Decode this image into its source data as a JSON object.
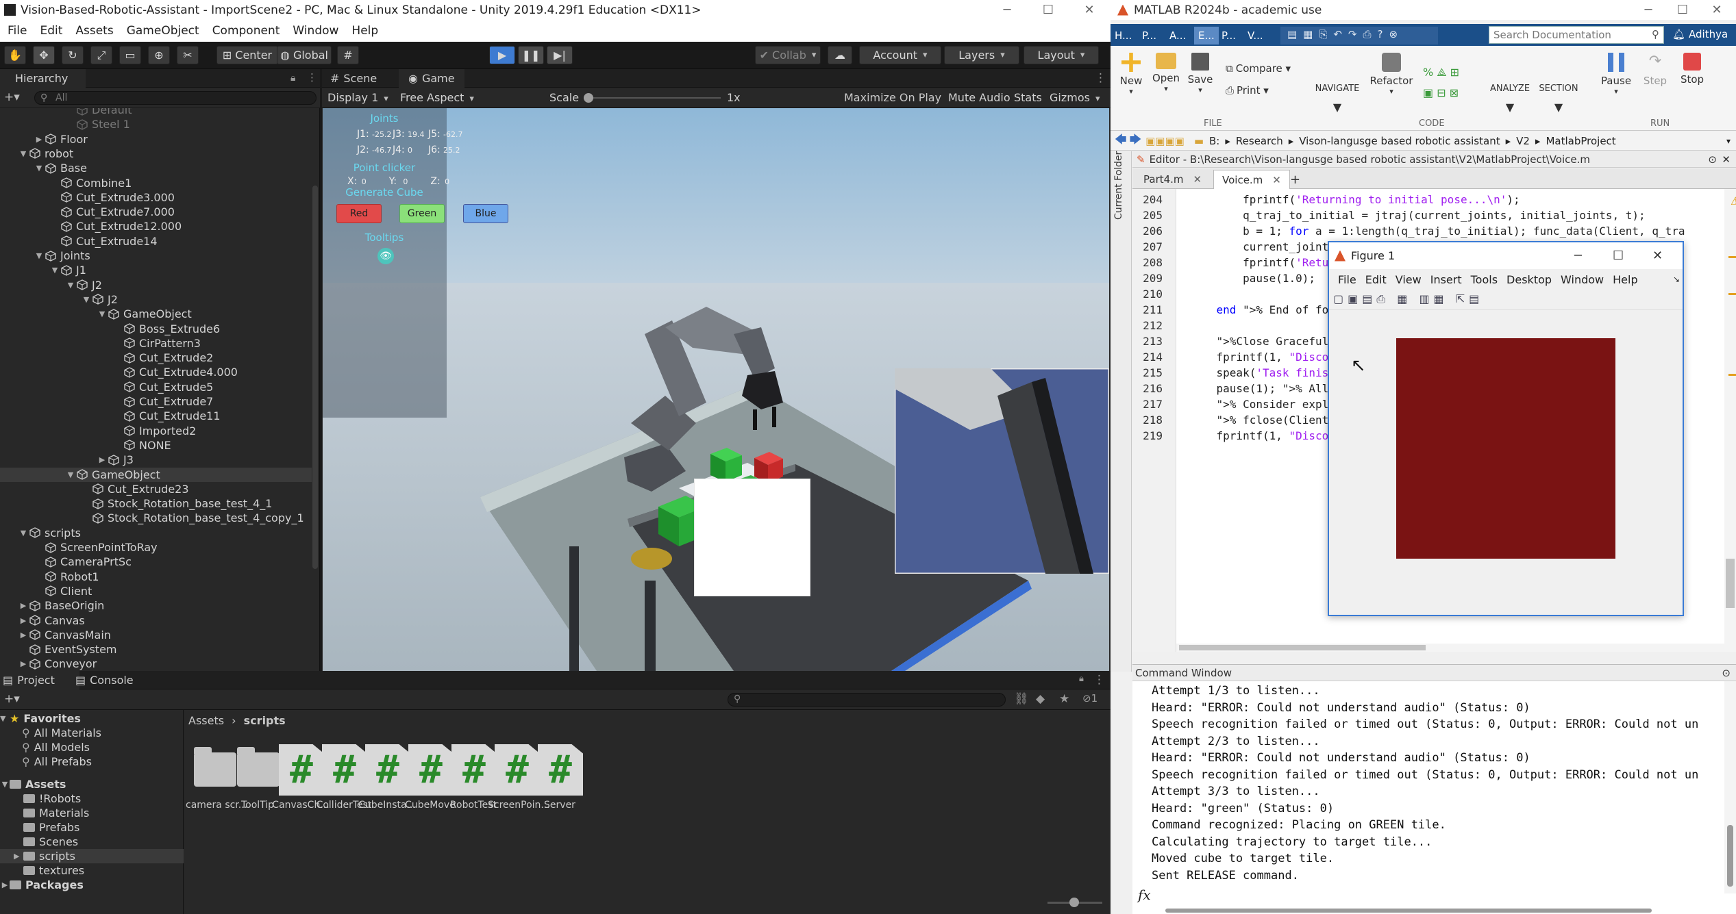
{
  "unity": {
    "title": "Vision-Based-Robotic-Assistant - ImportScene2 - PC, Mac & Linux Standalone - Unity 2019.4.29f1 Education <DX11>",
    "menu": [
      "File",
      "Edit",
      "Assets",
      "GameObject",
      "Component",
      "Window",
      "Help"
    ],
    "toolbar": {
      "pivot": "Center",
      "space": "Global",
      "collab": "Collab",
      "account": "Account",
      "layers": "Layers",
      "layout": "Layout"
    },
    "hierarchy": {
      "tab": "Hierarchy",
      "search_placeholder": "All",
      "items": [
        {
          "label": "Default"
        },
        {
          "label": "Steel 1"
        },
        {
          "label": "Floor"
        },
        {
          "label": "robot"
        },
        {
          "label": "Base"
        },
        {
          "label": "Combine1"
        },
        {
          "label": "Cut_Extrude3.000"
        },
        {
          "label": "Cut_Extrude7.000"
        },
        {
          "label": "Cut_Extrude12.000"
        },
        {
          "label": "Cut_Extrude14"
        },
        {
          "label": "Joints"
        },
        {
          "label": "J1"
        },
        {
          "label": "J2"
        },
        {
          "label": "J2"
        },
        {
          "label": "GameObject"
        },
        {
          "label": "Boss_Extrude6"
        },
        {
          "label": "CirPattern3"
        },
        {
          "label": "Cut_Extrude2"
        },
        {
          "label": "Cut_Extrude4.000"
        },
        {
          "label": "Cut_Extrude5"
        },
        {
          "label": "Cut_Extrude7"
        },
        {
          "label": "Cut_Extrude11"
        },
        {
          "label": "Imported2"
        },
        {
          "label": "NONE"
        },
        {
          "label": "J3"
        },
        {
          "label": "GameObject"
        },
        {
          "label": "Cut_Extrude23"
        },
        {
          "label": "Stock_Rotation_base_test_4_1"
        },
        {
          "label": "Stock_Rotation_base_test_4_copy_1"
        },
        {
          "label": "scripts"
        },
        {
          "label": "ScreenPointToRay"
        },
        {
          "label": "CameraPrtSc"
        },
        {
          "label": "Robot1"
        },
        {
          "label": "Client"
        },
        {
          "label": "BaseOrigin"
        },
        {
          "label": "Canvas"
        },
        {
          "label": "CanvasMain"
        },
        {
          "label": "EventSystem"
        },
        {
          "label": "Conveyor"
        }
      ]
    },
    "game": {
      "tabs": [
        "Scene",
        "Game"
      ],
      "display": "Display 1",
      "aspect": "Free Aspect",
      "scale_label": "Scale",
      "scale_value": "1x",
      "scale_fraction": 0,
      "options": [
        "Maximize On Play",
        "Mute Audio",
        "Stats",
        "Gizmos"
      ],
      "overlay": {
        "joints_title": "Joints",
        "joints_row1": [
          "J1:",
          "-25.2",
          "J3:",
          "19.4",
          "J5:",
          "-62.7"
        ],
        "joints_row2": [
          "J2:",
          "-46.7",
          "J4:",
          "0",
          "J6:",
          "25.2"
        ],
        "point_title": "Point clicker",
        "point_row": [
          "X:",
          "0",
          "Y:",
          "0",
          "Z:",
          "0"
        ],
        "cube_title": "Generate Cube",
        "buttons": {
          "red": "Red",
          "green": "Green",
          "blue": "Blue"
        },
        "tooltips": "Tooltips"
      }
    },
    "project": {
      "tabs": [
        "Project",
        "Console"
      ],
      "favorites_title": "Favorites",
      "favorites": [
        "All Materials",
        "All Models",
        "All Prefabs"
      ],
      "assets_title": "Assets",
      "folders": [
        "!Robots",
        "Materials",
        "Prefabs",
        "Scenes",
        "scripts",
        "textures"
      ],
      "packages": "Packages",
      "breadcrumb": [
        "Assets",
        "scripts"
      ],
      "hidden_count": "1",
      "items": [
        {
          "label": "camera scr...",
          "kind": "folder"
        },
        {
          "label": "ToolTip",
          "kind": "folder"
        },
        {
          "label": "CanvasCh...",
          "kind": "script"
        },
        {
          "label": "ColliderTest",
          "kind": "script"
        },
        {
          "label": "CubeInsta...",
          "kind": "script"
        },
        {
          "label": "CubeMove",
          "kind": "script"
        },
        {
          "label": "RobotTest",
          "kind": "script"
        },
        {
          "label": "ScreenPoin...",
          "kind": "script"
        },
        {
          "label": "Server",
          "kind": "script"
        }
      ]
    }
  },
  "matlab": {
    "title": "MATLAB R2024b - academic use",
    "user": "Adithya",
    "tabs": [
      "H...",
      "P...",
      "A...",
      "E...",
      "P...",
      "V..."
    ],
    "search_placeholder": "Search Documentation",
    "ribbon": {
      "new": "New",
      "open": "Open",
      "save": "Save",
      "compare": "Compare",
      "print": "Print",
      "navigate": "NAVIGATE",
      "refactor": "Refactor",
      "analyze": "ANALYZE",
      "section": "SECTION",
      "pause": "Pause",
      "step": "Step",
      "stop": "Stop",
      "groups": {
        "file": "FILE",
        "code": "CODE",
        "run": "RUN"
      }
    },
    "address": [
      "B:",
      "Research",
      "Vison-langusge based robotic assistant",
      "V2",
      "MatlabProject"
    ],
    "current_folder": "Current Folder",
    "editor_header": "Editor - B:\\Research\\Vison-langusge based robotic assistant\\V2\\MatlabProject\\Voice.m",
    "file_tabs": [
      "Part4.m",
      "Voice.m"
    ],
    "code": [
      {
        "n": "204",
        "t": "        fprintf('Returning to initial pose...\\n');"
      },
      {
        "n": "205",
        "t": "        q_traj_to_initial = jtraj(current_joints, initial_joints, t);"
      },
      {
        "n": "206",
        "t": "        b = 1; for a = 1:length(q_traj_to_initial); func_data(Client, q_tra"
      },
      {
        "n": "207",
        "t": "        current_joint"
      },
      {
        "n": "208",
        "t": "        fprintf('Retu"
      },
      {
        "n": "209",
        "t": "        pause(1.0);"
      },
      {
        "n": "210",
        "t": ""
      },
      {
        "n": "211",
        "t": "    end % End of for"
      },
      {
        "n": "212",
        "t": ""
      },
      {
        "n": "213",
        "t": "    %Close Gracefully"
      },
      {
        "n": "214",
        "t": "    fprintf(1, \"Disco"
      },
      {
        "n": "215",
        "t": "    speak('Task finis"
      },
      {
        "n": "216",
        "t": "    pause(1); % Allow"
      },
      {
        "n": "217",
        "t": "    % Consider explic"
      },
      {
        "n": "218",
        "t": "    % fclose(Client);"
      },
      {
        "n": "219",
        "t": "    fprintf(1, \"Disco"
      }
    ],
    "command_window_title": "Command Window",
    "command_lines": [
      "Attempt 1/3 to listen...",
      "Heard: \"ERROR: Could not understand audio\" (Status: 0)",
      "Speech recognition failed or timed out (Status: 0, Output: ERROR: Could not un",
      "Attempt 2/3 to listen...",
      "Heard: \"ERROR: Could not understand audio\" (Status: 0)",
      "Speech recognition failed or timed out (Status: 0, Output: ERROR: Could not un",
      "Attempt 3/3 to listen...",
      "Heard: \"green\" (Status: 0)",
      "Command recognized: Placing on GREEN tile.",
      "Calculating trajectory to target tile...",
      "Moved cube to target tile.",
      "Sent RELEASE command."
    ],
    "prompt": "fx"
  },
  "figure": {
    "title": "Figure 1",
    "menu": [
      "File",
      "Edit",
      "View",
      "Insert",
      "Tools",
      "Desktop",
      "Window",
      "Help"
    ],
    "axes_color": "#7a1313"
  },
  "colors": {
    "unity_bg": "#191919",
    "unity_panel": "#282828",
    "play_active": "#3e7bd1",
    "matlab_tabbar": "#1b4f89",
    "figure_axes": "#7a1313"
  }
}
